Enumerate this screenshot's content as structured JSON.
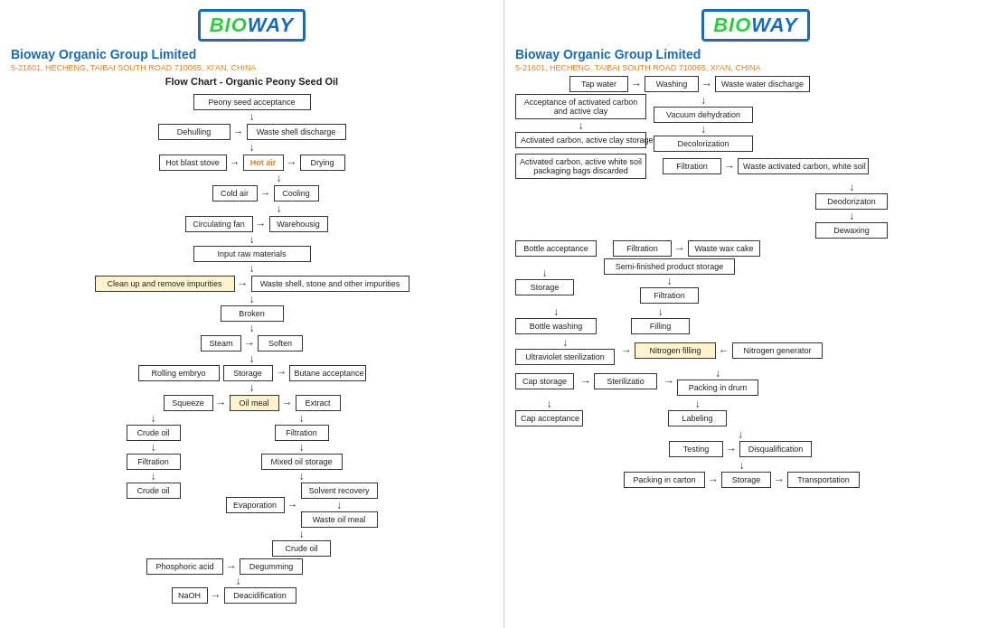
{
  "left": {
    "logo": "BIOWAY",
    "company_name": "Bioway Organic Group Limited",
    "address": "5-21601, HECHENG, TAIBAI SOUTH ROAD 710065, XI'AN, CHINA",
    "chart_title": "Flow Chart - Organic Peony Seed Oil",
    "nodes": {
      "peony_seed": "Peony seed acceptance",
      "dehulling": "Dehulling",
      "waste_shell": "Waste shell discharge",
      "hot_blast": "Hot blast stove",
      "hot_air": "Hot air",
      "drying": "Drying",
      "cold_air": "Cold air",
      "cooling": "Cooling",
      "circulating_fan": "Circulating fan",
      "warehousing": "Warehousig",
      "input_raw": "Input raw materials",
      "clean_up": "Clean up and remove impurities",
      "waste_shell2": "Waste shell, stone and other impurities",
      "broken": "Broken",
      "steam": "Steam",
      "soften": "Soften",
      "storage": "Storage",
      "butane": "Butane acceptance",
      "rolling": "Rolling embryo",
      "squeeze": "Squeeze",
      "oil_meal": "Oil meal",
      "extract": "Extract",
      "crude_oil1": "Crude oil",
      "filtration1": "Filtration",
      "crude_oil2": "Crude oil",
      "mixed_oil": "Mixed oil storage",
      "filtration2": "Filtration",
      "evaporation": "Evaporation",
      "solvent_recovery": "Solvent recovery",
      "waste_oil_meal": "Waste oil meal",
      "crude_oil3": "Crude oil",
      "phosphoric_acid": "Phosphoric acid",
      "degumming": "Degumming",
      "naoh": "NaOH",
      "deacidification": "Deacidification"
    }
  },
  "right": {
    "logo": "BIOWAY",
    "company_name": "Bioway Organic Group Limited",
    "address": "5-21601, HECHENG, TAIBAI SOUTH ROAD 710065, XI'AN, CHINA",
    "nodes": {
      "tap_water": "Tap water",
      "washing": "Washing",
      "waste_water": "Waste water discharge",
      "acceptance_carbon": "Acceptance of activated carbon and active clay",
      "vacuum": "Vacuum dehydration",
      "activated_storage": "Activated carbon, active clay storage",
      "decolorization": "Decolorization",
      "activated_white": "Activated carbon, active white soil packaging bags discarded",
      "filtration1": "Filtration",
      "waste_carbon": "Waste activated carbon, white soil",
      "deodorization": "Deodorizaton",
      "dewaxing": "Dewaxing",
      "bottle_accept": "Bottle acceptance",
      "filtration2": "Filtration",
      "waste_wax": "Waste wax cake",
      "storage1": "Storage",
      "semi_finished": "Semi-finished product storage",
      "bottle_washing": "Bottle washing",
      "filtration3": "Filtration",
      "uv_sterilization": "Ultraviolet sterilization",
      "filling": "Filling",
      "nitrogen_filling": "Nitrogen filling",
      "nitrogen_gen": "Nitrogen generator",
      "cap_storage": "Cap storage",
      "sterilization": "Sterilizatio",
      "packing_drum": "Packing in drum",
      "cap_acceptance": "Cap acceptance",
      "labeling": "Labeling",
      "testing": "Testing",
      "disqualification": "Disqualification",
      "packing_carton": "Packing in carton",
      "storage2": "Storage",
      "transportation": "Transportation"
    }
  }
}
